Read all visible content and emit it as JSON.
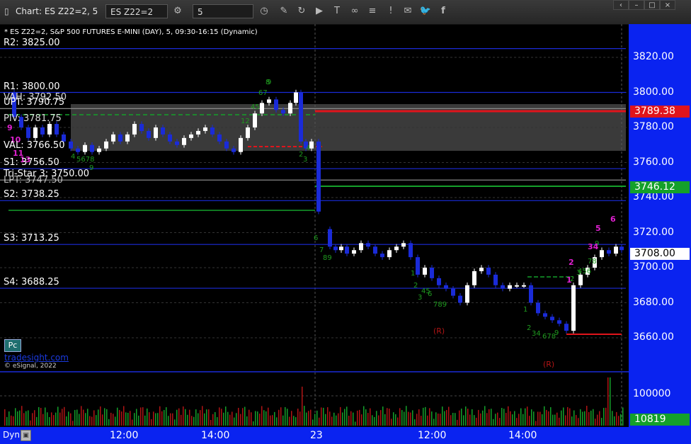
{
  "window": {
    "title": "Chart: ES Z22=2, 5",
    "symbol": "ES Z22=2",
    "interval": "5"
  },
  "chart_header": "* ES Z22=2, S&P 500 FUTURES E-MINI (DAY), 5, 09:30-16:15 (Dynamic)",
  "levels": [
    {
      "label": "R2: 3825.00",
      "price": 3825.0,
      "color": "#1a2bd8"
    },
    {
      "label": "R1: 3800.00",
      "price": 3800.0,
      "color": "#1a2bd8"
    },
    {
      "label": "UPT: 3790.75",
      "price": 3790.75,
      "color": "#888"
    },
    {
      "label": "S1: 3756.50",
      "price": 3756.5,
      "color": "#1a2bd8"
    },
    {
      "label": "Tri-Star 3: 3750.00",
      "price": 3750.0,
      "color": "#888"
    },
    {
      "label": "S2: 3738.25",
      "price": 3738.25,
      "color": "#1a2bd8"
    },
    {
      "label": "S3: 3713.25",
      "price": 3713.25,
      "color": "#1a2bd8"
    },
    {
      "label": "S4: 3688.25",
      "price": 3688.25,
      "color": "#1a2bd8"
    }
  ],
  "partial_labels": [
    "VAH: 3792.50",
    "PIV: 3781.75",
    "VAL: 3766.50",
    "LPT: 3747.50"
  ],
  "y_axis": {
    "ticks": [
      "3820.00",
      "3800.00",
      "3780.00",
      "3760.00",
      "3740.00",
      "3720.00",
      "3700.00",
      "3680.00",
      "3660.00"
    ],
    "tick_values": [
      3820,
      3800,
      3780,
      3760,
      3740,
      3720,
      3700,
      3680,
      3660
    ]
  },
  "price_tags": [
    {
      "text": "3789.38",
      "price": 3789.38,
      "bg": "#e0141c",
      "fg": "#fff"
    },
    {
      "text": "3746.12",
      "price": 3746.12,
      "bg": "#14a02a",
      "fg": "#fff"
    },
    {
      "text": "3708.00",
      "price": 3708.0,
      "bg": "#ffffff",
      "fg": "#000"
    }
  ],
  "volume_axis": {
    "tick": "100000",
    "last": "10819"
  },
  "x_axis": {
    "labels": [
      "12:00",
      "14:00",
      "23",
      "12:00",
      "14:00"
    ]
  },
  "markers": {
    "r1": "(R)",
    "r2": "(R)"
  },
  "footer": {
    "badge": "Pc",
    "link": "tradesight.com",
    "copyright": "© eSignal, 2022",
    "dyn": "Dyn"
  },
  "colors": {
    "up": "#ffffff",
    "down": "#1a2bd8",
    "axis": "#0a23f0",
    "setup": "#1f9a1f",
    "countdown": "#e020d0"
  }
}
